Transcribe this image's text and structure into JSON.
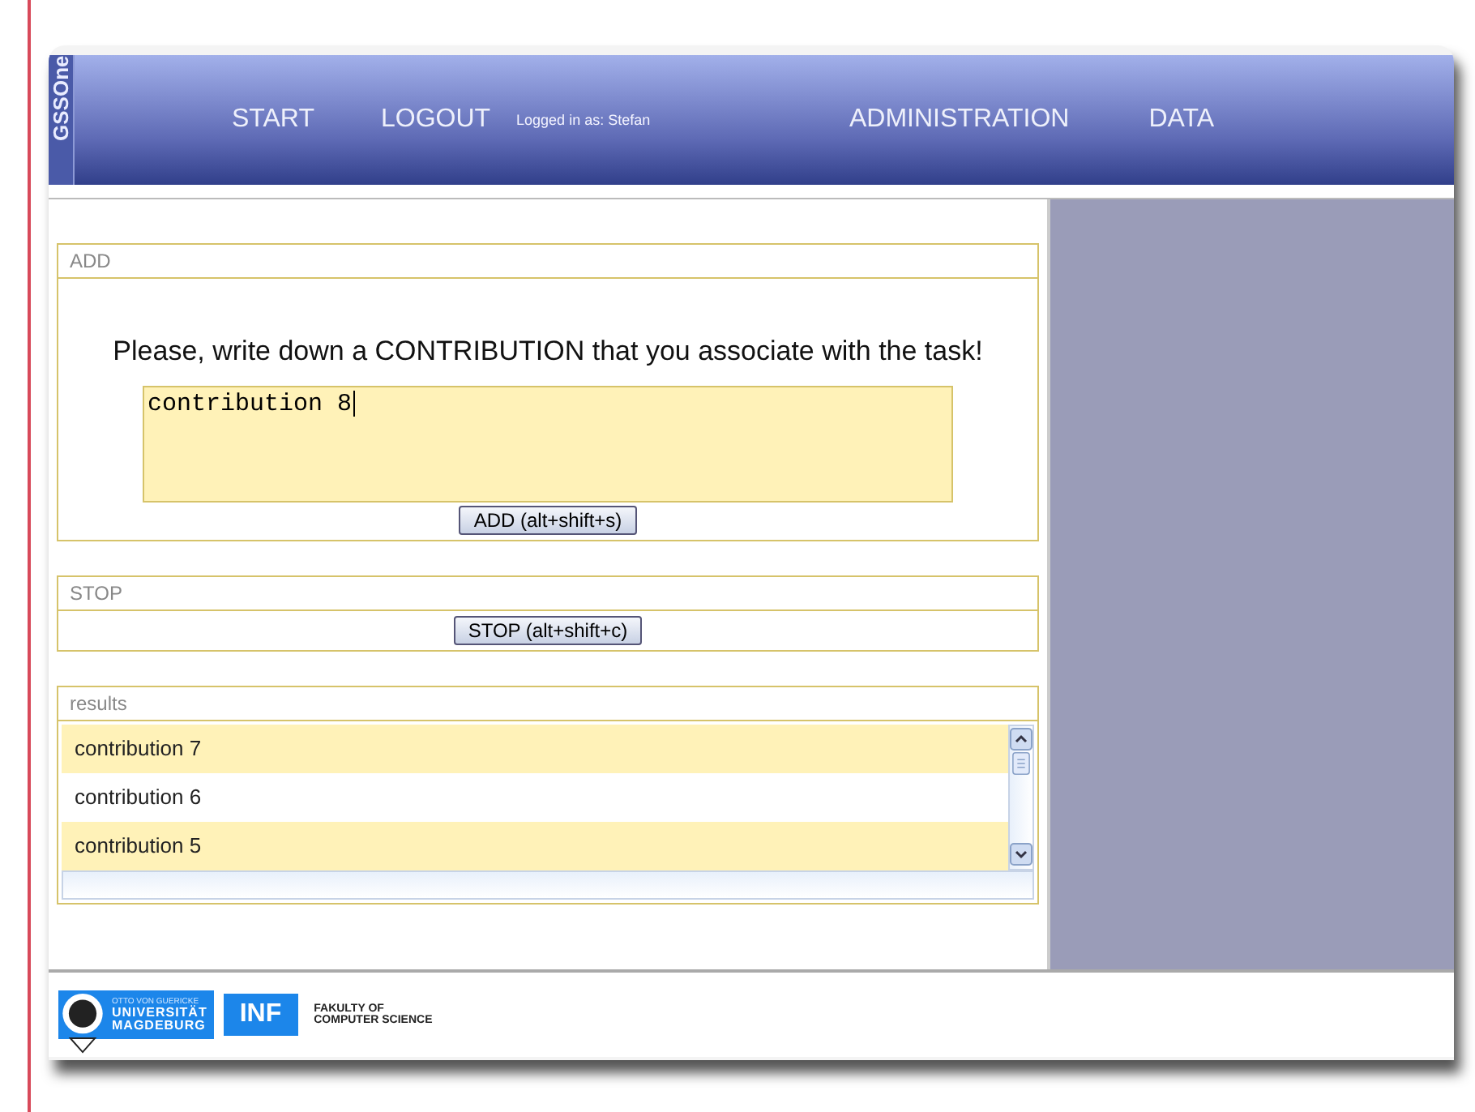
{
  "brand": "GSSOne",
  "nav": [
    {
      "label": "START"
    },
    {
      "label": "LOGOUT"
    },
    {
      "label": "Logged in as: Stefan",
      "kind": "status"
    },
    {
      "label": "ADMINISTRATION"
    },
    {
      "label": "DATA"
    }
  ],
  "add_panel": {
    "title": "ADD",
    "prompt": "Please, write down a CONTRIBUTION that you associate with the task!",
    "value": "contribution 8",
    "button": "ADD (alt+shift+s)"
  },
  "stop_panel": {
    "title": "STOP",
    "button": "STOP (alt+shift+c)"
  },
  "results": {
    "title": "results",
    "rows": [
      "contribution 7",
      "contribution 6",
      "contribution 5"
    ]
  },
  "footer": {
    "university": [
      "OTTO VON GUERICKE",
      "UNIVERSITÄT",
      "MAGDEBURG"
    ],
    "faculty_logo": "INF",
    "faculty": [
      "FAKULTY OF",
      "COMPUTER SCIENCE"
    ]
  }
}
